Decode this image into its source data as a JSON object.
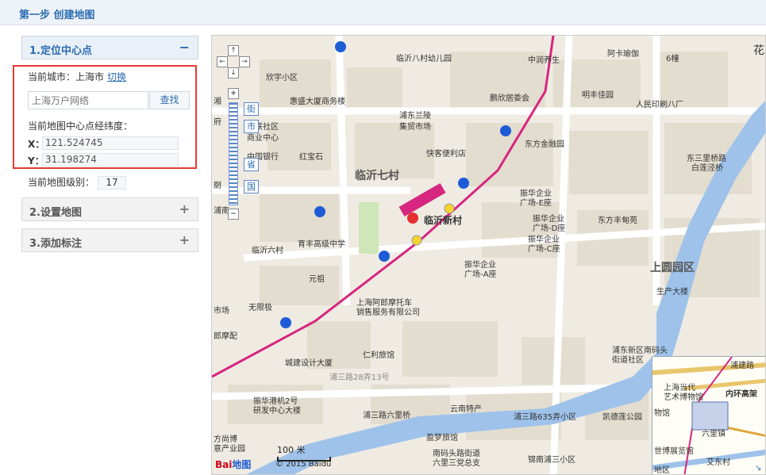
{
  "header": {
    "title": "第一步 创建地图"
  },
  "panels": {
    "locate": {
      "title": "1.定位中心点",
      "toggle": "−"
    },
    "settings": {
      "title": "2.设置地图",
      "toggle": "+"
    },
    "markers": {
      "title": "3.添加标注",
      "toggle": "+"
    }
  },
  "locate": {
    "city_label": "当前城市：上海市",
    "switch_label": "切换",
    "search": {
      "placeholder": "上海万户网络",
      "button": "查找"
    },
    "center_label": "当前地图中心点经纬度：",
    "x_label": "X：",
    "x_value": "121.524745",
    "y_label": "Y：",
    "y_value": "31.198274",
    "zoom_label": "当前地图级别：",
    "zoom_value": "17"
  },
  "map": {
    "big_labels": [
      "临沂七村",
      "上圆园区"
    ],
    "station": "临沂新村",
    "labels": {
      "l1": "临沂八村幼儿园",
      "l2": "中润养生",
      "l3": "阿卡瑜伽",
      "l4": "6幢",
      "l5": "花",
      "l6": "欣宇小区",
      "l7": "惠盛大厦商务楼",
      "l8": "鹏欣居委会",
      "l9": "明丰佳园",
      "l10": "人民印刷八厂",
      "l11": "浦东兰陵",
      "l12": "集贸市场",
      "l13": "百联社区",
      "l14": "商业中心",
      "l15": "快客便利店",
      "l16": "东方金融园",
      "l17": "东三里桥路",
      "l18": "白莲泾桥",
      "l19": "中国银行",
      "l20": "红宝石",
      "l21": "振华企业",
      "l22": "广场-E座",
      "l23": "振华企业",
      "l24": "广场-D座",
      "l25": "东方丰甸苑",
      "l26": "振华企业",
      "l27": "广场-C座",
      "l28": "育丰高级中学",
      "l29": "临沂六村",
      "l30": "振华企业",
      "l31": "广场-A座",
      "l32": "元祖",
      "l33": "生产大楼",
      "l34": "上海阿郎摩托车",
      "l35": "销售服务有限公司",
      "l36": "无限极",
      "l37": "市场",
      "l38": "郎摩配",
      "l39": "仁利旅馆",
      "l40": "城建设计大厦",
      "l41": "浦三路28弄13号",
      "l42": "浦东新区南码头",
      "l43": "街道社区",
      "l44": "振华港机2号",
      "l45": "研发中心大楼",
      "l46": "浦三路六里桥",
      "l47": "云南特产",
      "l48": "浦三路635弄小区",
      "l49": "凯德莲公园",
      "l50": "盈梦旅馆",
      "l51": "南码头路街道",
      "l52": "六里三党总支",
      "l53": "锦南浦三小区",
      "l54": "方尚博",
      "l55": "意产业园",
      "l56": "湘",
      "l57": "浦南",
      "l58": "厨",
      "l59": "府"
    },
    "nav": {
      "levels": [
        "街",
        "市",
        "省",
        "国"
      ]
    },
    "scale_label": "100 米",
    "logo_text": "Bai",
    "logo_du": "地图",
    "copyright": "© 2015 Baidu",
    "overview": {
      "labels": [
        "浦建路",
        "上海当代",
        "艺术博物馆",
        "内环高架",
        "物馆",
        "六里镇",
        "世博展览馆",
        "艾东村",
        "地区"
      ]
    }
  }
}
